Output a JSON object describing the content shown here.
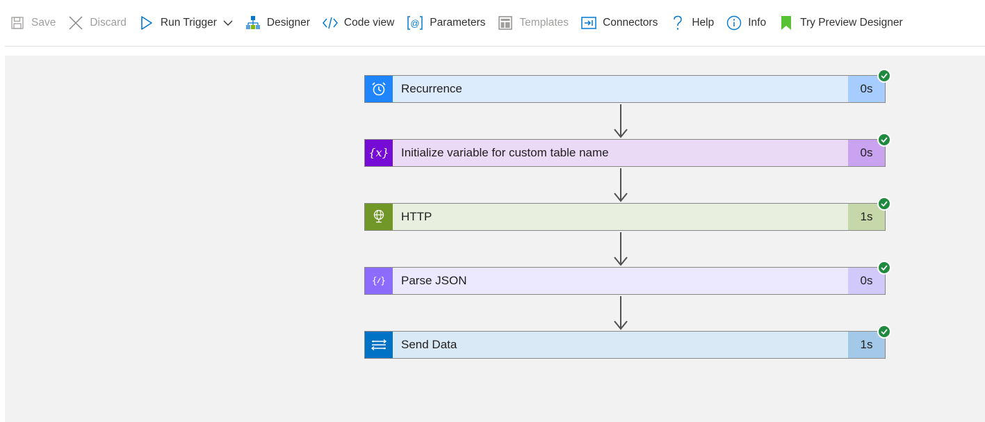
{
  "toolbar": {
    "items": [
      {
        "label": "Save",
        "icon": "save-icon",
        "disabled": true
      },
      {
        "label": "Discard",
        "icon": "discard-icon",
        "disabled": true
      },
      {
        "label": "Run Trigger",
        "icon": "run-trigger-icon",
        "disabled": false
      },
      {
        "label": "Designer",
        "icon": "designer-icon",
        "disabled": false
      },
      {
        "label": "Code view",
        "icon": "code-view-icon",
        "disabled": false
      },
      {
        "label": "Parameters",
        "icon": "parameters-icon",
        "disabled": false
      },
      {
        "label": "Templates",
        "icon": "templates-icon",
        "disabled": true
      },
      {
        "label": "Connectors",
        "icon": "connectors-icon",
        "disabled": false
      },
      {
        "label": "Help",
        "icon": "help-icon",
        "disabled": false
      },
      {
        "label": "Info",
        "icon": "info-icon",
        "disabled": false
      },
      {
        "label": "Try Preview Designer",
        "icon": "bookmark-icon",
        "disabled": false
      }
    ]
  },
  "workflow": {
    "steps": [
      {
        "title": "Recurrence",
        "duration": "0s",
        "status": "succeeded",
        "icon": "alarm-clock-icon",
        "accent": "#1f85ff",
        "body": "#ddecfd",
        "durBg": "#a6cdfd"
      },
      {
        "title": "Initialize variable for custom table name",
        "duration": "0s",
        "status": "succeeded",
        "icon": "variable-icon",
        "accent": "#770bd6",
        "body": "#ebdaf6",
        "durBg": "#c9a3ef"
      },
      {
        "title": "HTTP",
        "duration": "1s",
        "status": "succeeded",
        "icon": "globe-icon",
        "accent": "#709727",
        "body": "#e8efdf",
        "durBg": "#c6d7aa"
      },
      {
        "title": "Parse JSON",
        "duration": "0s",
        "status": "succeeded",
        "icon": "parse-json-icon",
        "accent": "#8c6cff",
        "body": "#ece8fd",
        "durBg": "#d2c9fb"
      },
      {
        "title": "Send Data",
        "duration": "1s",
        "status": "succeeded",
        "icon": "send-data-icon",
        "accent": "#0072c6",
        "body": "#d9e9f6",
        "durBg": "#a3c8e8"
      }
    ]
  }
}
